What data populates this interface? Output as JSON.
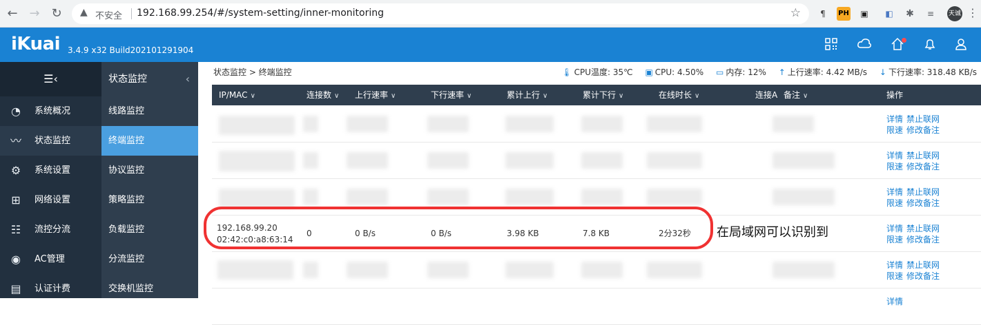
{
  "browser": {
    "security_label": "不安全",
    "url": "192.168.99.254/#/system-setting/inner-monitoring",
    "extensions": [
      "¶",
      "PH",
      "▣",
      "◧",
      "✎",
      "≡"
    ],
    "avatar_text": "天诚"
  },
  "header": {
    "logo": "iKuai",
    "version": "3.4.9 x32 Build202101291904",
    "icons": [
      "qr-icon",
      "cloud-icon",
      "home-icon",
      "bell-icon",
      "user-icon"
    ]
  },
  "sidebar": {
    "items": [
      {
        "label": "系统概况",
        "icon": "dashboard-icon"
      },
      {
        "label": "状态监控",
        "icon": "pulse-icon"
      },
      {
        "label": "系统设置",
        "icon": "gear-icon"
      },
      {
        "label": "网络设置",
        "icon": "network-icon"
      },
      {
        "label": "流控分流",
        "icon": "sliders-icon"
      },
      {
        "label": "AC管理",
        "icon": "wifi-icon"
      },
      {
        "label": "认证计费",
        "icon": "card-icon"
      }
    ]
  },
  "submenu": {
    "title": "状态监控",
    "items": [
      "线路监控",
      "终端监控",
      "协议监控",
      "策略监控",
      "负载监控",
      "分流监控",
      "交换机监控"
    ]
  },
  "breadcrumb": "状态监控 > 终端监控",
  "stats": {
    "cpu_temp": "CPU温度: 35℃",
    "cpu": "CPU: 4.50%",
    "memory": "内存: 12%",
    "upload": "上行速率: 4.42 MB/s",
    "download": "下行速率: 318.48 KB/s"
  },
  "table": {
    "headers": [
      "IP/MAC",
      "连接数",
      "上行速率",
      "下行速率",
      "累计上行",
      "累计下行",
      "在线时长",
      "连接A",
      "备注",
      "操作"
    ],
    "highlight_row": {
      "ip": "192.168.99.20",
      "mac": "02:42:c0:a8:63:14",
      "connections": "0",
      "upload_rate": "0 B/s",
      "download_rate": "0 B/s",
      "total_up": "3.98 KB",
      "total_down": "7.8 KB",
      "online_time": "2分32秒"
    },
    "ops": {
      "details": "详情",
      "block": "禁止联网",
      "limit": "限速",
      "edit_note": "修改备注"
    }
  },
  "annotation": "在局域网可以识别到"
}
